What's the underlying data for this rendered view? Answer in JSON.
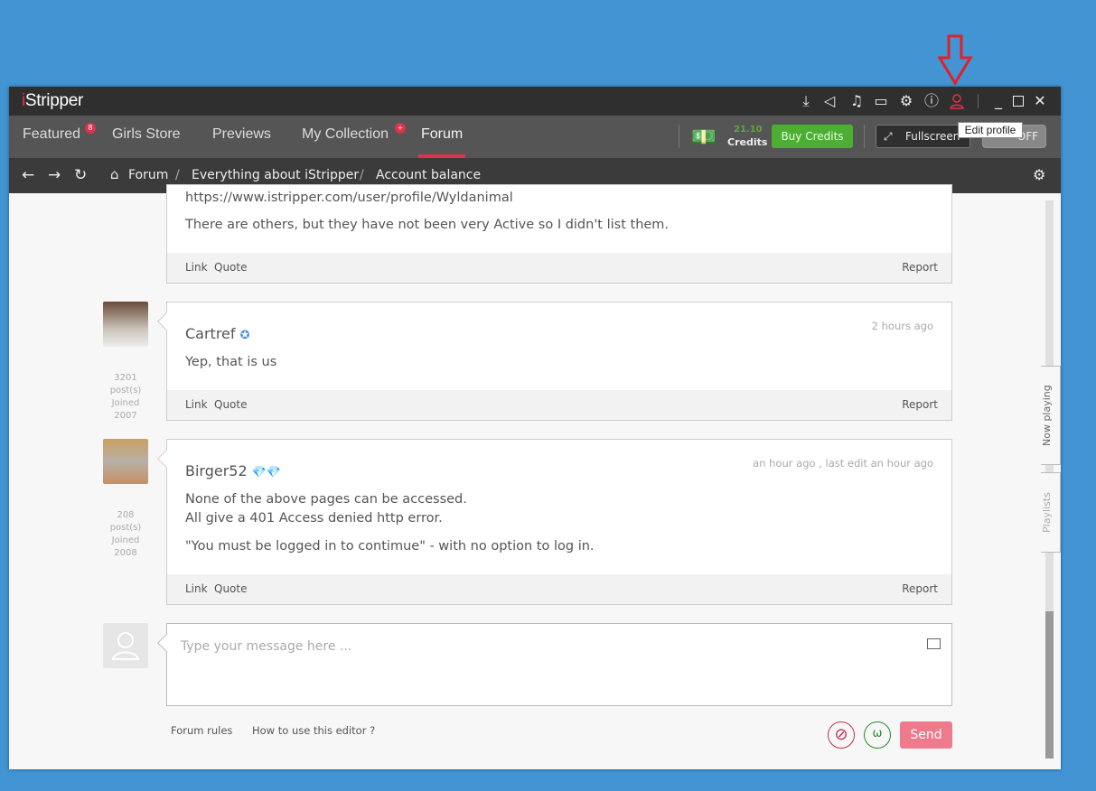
{
  "app": {
    "logo": "iStripper"
  },
  "tooltip": "Edit profile",
  "nav": {
    "items": [
      {
        "label": "Featured",
        "badge": "8"
      },
      {
        "label": "Girls Store"
      },
      {
        "label": "Previews"
      },
      {
        "label": "My Collection",
        "badge": "+"
      },
      {
        "label": "Forum"
      }
    ],
    "credits_value": "21.10",
    "credits_label": "Credits",
    "buy_credits": "Buy Credits",
    "fullscreen": "Fullscreen",
    "toggle": "OFF"
  },
  "breadcrumb": [
    "Forum",
    "Everything about iStripper",
    "Account balance"
  ],
  "posts": [
    {
      "lines": [
        "https://www.istripper.com/user/profile/Wyldanimal",
        "There are others, but they have not been very Active so I didn't list them."
      ]
    },
    {
      "author": "Cartref",
      "time": "2 hours ago",
      "posts": "3201",
      "posts_label": "post(s)",
      "joined_label": "Joined",
      "joined": "2007",
      "lines": [
        "Yep, that is us"
      ]
    },
    {
      "author": "Birger52",
      "time": "an hour ago , last edit an hour ago",
      "posts": "208",
      "posts_label": "post(s)",
      "joined_label": "Joined",
      "joined": "2008",
      "lines": [
        "None of the above pages can be accessed.",
        "All give a 401 Access denied http error.",
        "\"You must be logged in to contimue\" - with no option to log in."
      ]
    }
  ],
  "actions": {
    "link": "Link",
    "quote": "Quote",
    "report": "Report"
  },
  "composer": {
    "placeholder": "Type your message here ...",
    "forum_rules": "Forum rules",
    "how_to": "How to use this editor ?",
    "send": "Send"
  },
  "side_tabs": {
    "now_playing": "Now playing",
    "playlists": "Playlists"
  },
  "colors": {
    "accent": "#e0324d",
    "buy": "#4caf33",
    "send": "#ee7a8c"
  }
}
